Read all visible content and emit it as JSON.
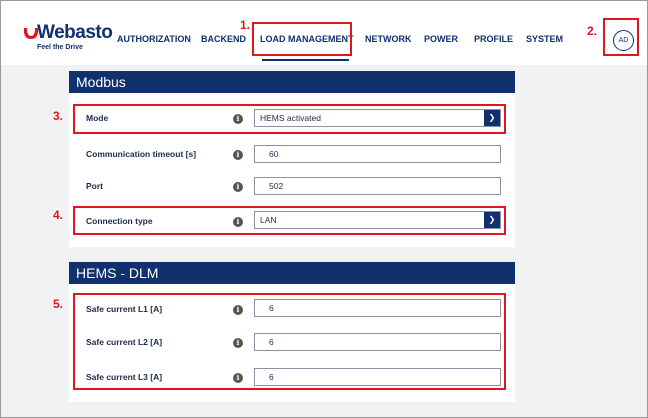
{
  "brand": {
    "name": "Webasto",
    "tagline": "Feel the Drive",
    "color": "#10306e"
  },
  "nav": {
    "items": [
      "AUTHORIZATION",
      "BACKEND",
      "LOAD MANAGEMENT",
      "NETWORK",
      "POWER",
      "PROFILE",
      "SYSTEM"
    ],
    "active": "LOAD MANAGEMENT"
  },
  "user": {
    "initials": "AD"
  },
  "modbus": {
    "title": "Modbus",
    "mode": {
      "label": "Mode",
      "value": "HEMS activated"
    },
    "timeout": {
      "label": "Communication timeout [s]",
      "value": "60"
    },
    "port": {
      "label": "Port",
      "value": "502"
    },
    "connection_type": {
      "label": "Connection type",
      "value": "LAN"
    }
  },
  "hems_dlm": {
    "title": "HEMS - DLM",
    "l1": {
      "label": "Safe current L1 [A]",
      "value": "6"
    },
    "l2": {
      "label": "Safe current L2 [A]",
      "value": "6"
    },
    "l3": {
      "label": "Safe current L3 [A]",
      "value": "6"
    }
  },
  "annotations": [
    "1.",
    "2.",
    "3.",
    "4.",
    "5."
  ],
  "icons": {
    "info": "info-icon",
    "dropdown": "chevron-down-icon"
  },
  "colors": {
    "accent": "#10306e",
    "annotation": "#e0161e"
  }
}
